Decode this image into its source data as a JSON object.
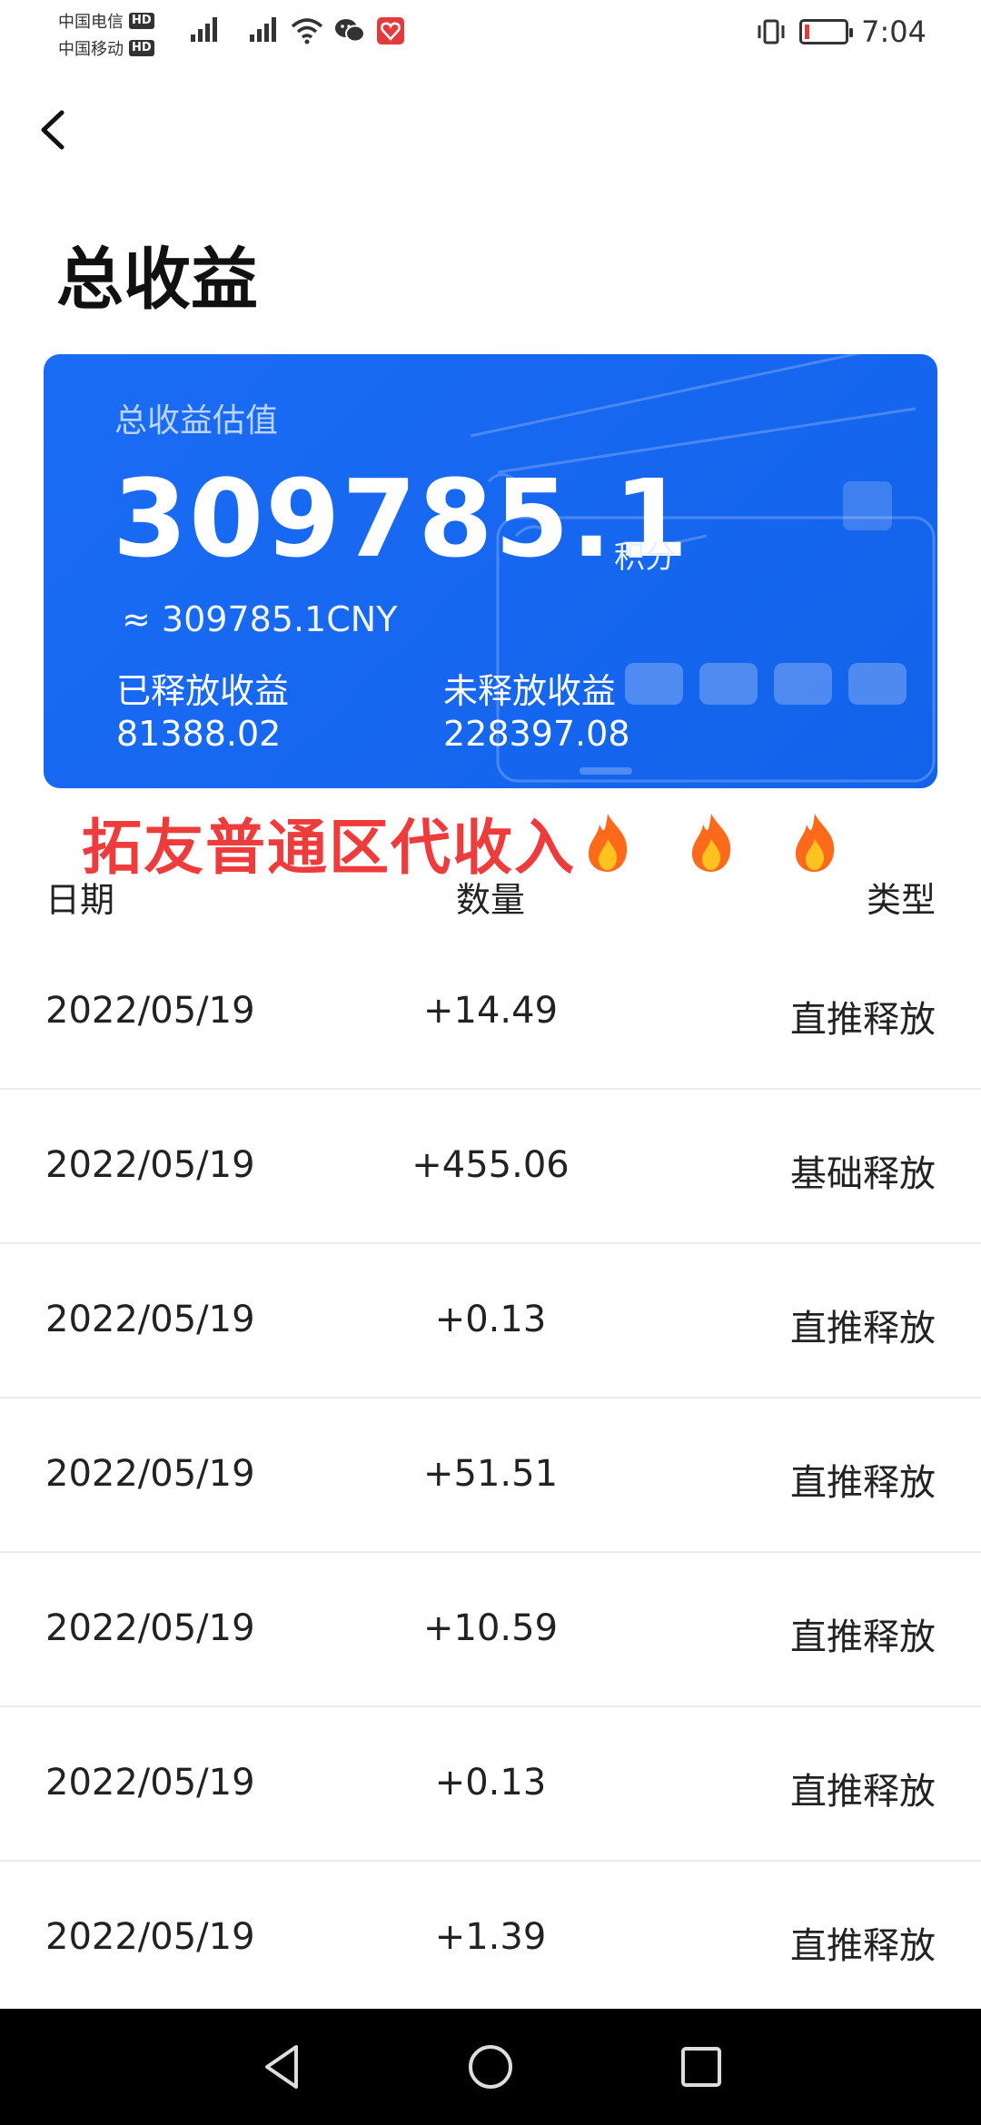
{
  "status_bar": {
    "carrier1": "中国电信",
    "carrier2": "中国移动",
    "hd_badge": "HD",
    "time": "7:04",
    "icons": [
      "signal-icon",
      "signal-icon",
      "wifi-icon",
      "wechat-icon",
      "app-notification-icon",
      "vibrate-icon",
      "battery-low-icon"
    ]
  },
  "header": {
    "back_icon": "chevron-left-icon",
    "title": "总收益"
  },
  "card": {
    "label": "总收益估值",
    "value": "309785.1",
    "unit": "积分",
    "cny": "≈ 309785.1CNY",
    "released_label": "已释放收益",
    "released_value": "81388.02",
    "unreleased_label": "未释放收益",
    "unreleased_value": "228397.08",
    "colors": {
      "card_bg": "#1b6cf5",
      "promo_red": "#ee3b3b"
    }
  },
  "promo": {
    "text": "拓友普通区代收入",
    "icons": [
      "fire-icon",
      "fire-icon",
      "fire-icon"
    ]
  },
  "table": {
    "headers": {
      "date": "日期",
      "amount": "数量",
      "type": "类型"
    },
    "rows": [
      {
        "date": "2022/05/19",
        "amount": "+14.49",
        "type": "直推释放"
      },
      {
        "date": "2022/05/19",
        "amount": "+455.06",
        "type": "基础释放"
      },
      {
        "date": "2022/05/19",
        "amount": "+0.13",
        "type": "直推释放"
      },
      {
        "date": "2022/05/19",
        "amount": "+51.51",
        "type": "直推释放"
      },
      {
        "date": "2022/05/19",
        "amount": "+10.59",
        "type": "直推释放"
      },
      {
        "date": "2022/05/19",
        "amount": "+0.13",
        "type": "直推释放"
      },
      {
        "date": "2022/05/19",
        "amount": "+1.39",
        "type": "直推释放"
      }
    ]
  },
  "nav_bar": {
    "icons": [
      "nav-back-icon",
      "nav-home-icon",
      "nav-recent-icon"
    ]
  }
}
